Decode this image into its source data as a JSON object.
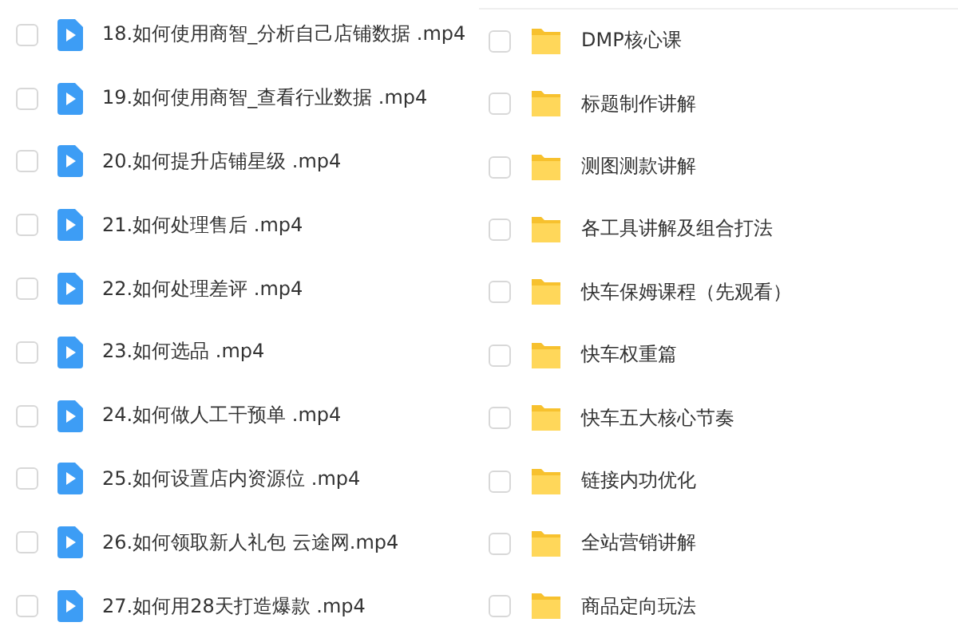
{
  "panels": [
    {
      "items": [
        {
          "kind": "video",
          "name": "18.如何使用商智_分析自己店铺数据 .mp4",
          "checked": false
        },
        {
          "kind": "video",
          "name": "19.如何使用商智_查看行业数据 .mp4",
          "checked": false
        },
        {
          "kind": "video",
          "name": "20.如何提升店铺星级 .mp4",
          "checked": false
        },
        {
          "kind": "video",
          "name": "21.如何处理售后 .mp4",
          "checked": false
        },
        {
          "kind": "video",
          "name": "22.如何处理差评 .mp4",
          "checked": false
        },
        {
          "kind": "video",
          "name": "23.如何选品 .mp4",
          "checked": false
        },
        {
          "kind": "video",
          "name": "24.如何做人工干预单 .mp4",
          "checked": false
        },
        {
          "kind": "video",
          "name": "25.如何设置店内资源位 .mp4",
          "checked": false
        },
        {
          "kind": "video",
          "name": "26.如何领取新人礼包 云途网.mp4",
          "checked": false
        },
        {
          "kind": "video",
          "name": "27.如何用28天打造爆款 .mp4",
          "checked": false
        }
      ]
    },
    {
      "items": [
        {
          "kind": "folder",
          "name": "DMP核心课",
          "checked": false
        },
        {
          "kind": "folder",
          "name": "标题制作讲解",
          "checked": false
        },
        {
          "kind": "folder",
          "name": "测图测款讲解",
          "checked": false
        },
        {
          "kind": "folder",
          "name": "各工具讲解及组合打法",
          "checked": false
        },
        {
          "kind": "folder",
          "name": "快车保姆课程（先观看）",
          "checked": false
        },
        {
          "kind": "folder",
          "name": "快车权重篇",
          "checked": false
        },
        {
          "kind": "folder",
          "name": "快车五大核心节奏",
          "checked": false
        },
        {
          "kind": "folder",
          "name": "链接内功优化",
          "checked": false
        },
        {
          "kind": "folder",
          "name": "全站营销讲解",
          "checked": false
        },
        {
          "kind": "folder",
          "name": "商品定向玩法",
          "checked": false
        }
      ]
    }
  ]
}
